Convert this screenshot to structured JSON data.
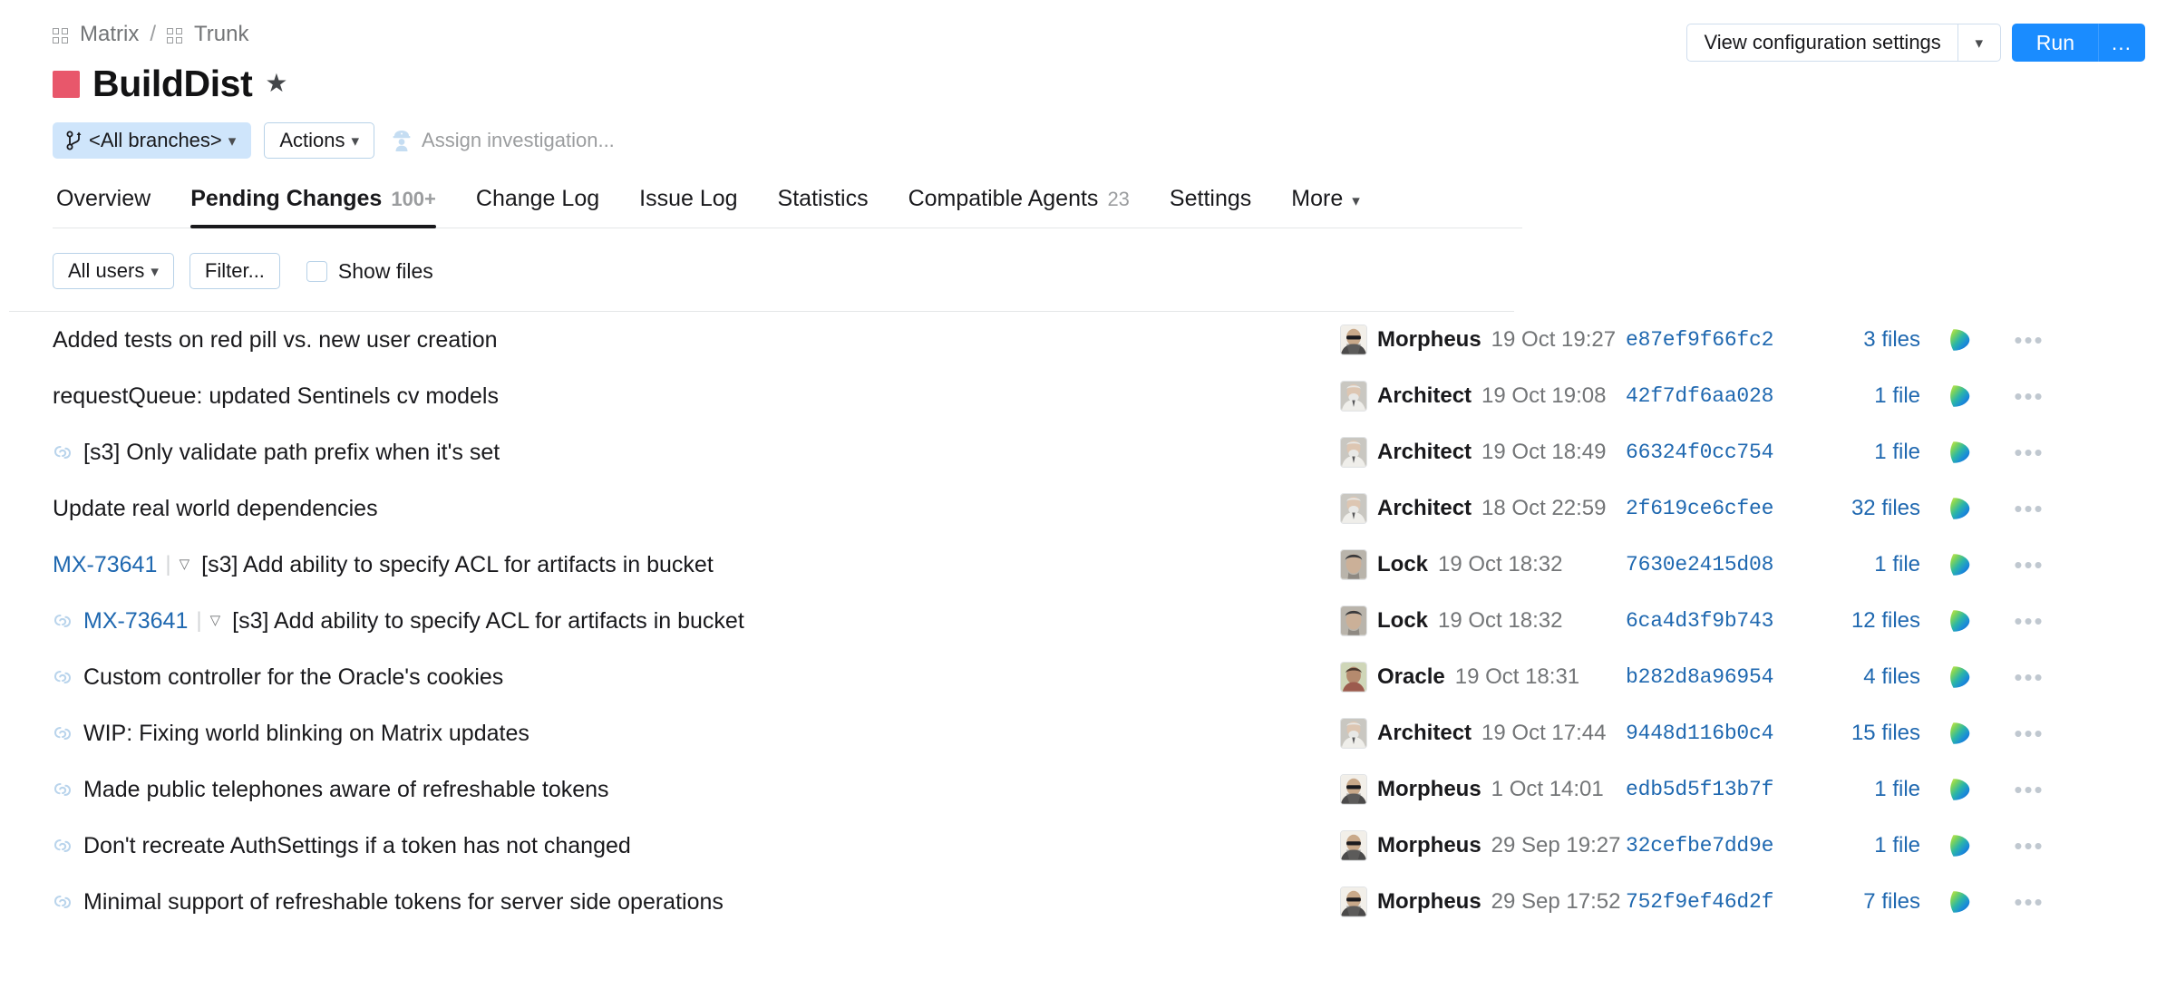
{
  "breadcrumb": {
    "root": "Matrix",
    "separator": "/",
    "child": "Trunk"
  },
  "project": {
    "title": "BuildDist",
    "star": "★",
    "color": "#e8576b"
  },
  "actions": {
    "branch_label": "<All branches>",
    "actions_label": "Actions",
    "assign_label": "Assign investigation..."
  },
  "topbar": {
    "view_config_label": "View configuration settings",
    "run_label": "Run",
    "more_label": "..."
  },
  "tabs": [
    {
      "label": "Overview",
      "count": "",
      "active": false
    },
    {
      "label": "Pending Changes",
      "count": "100+",
      "active": true
    },
    {
      "label": "Change Log",
      "count": "",
      "active": false
    },
    {
      "label": "Issue Log",
      "count": "",
      "active": false
    },
    {
      "label": "Statistics",
      "count": "",
      "active": false
    },
    {
      "label": "Compatible Agents",
      "count": "23",
      "active": false
    },
    {
      "label": "Settings",
      "count": "",
      "active": false
    },
    {
      "label": "More",
      "count": "",
      "active": false,
      "caret": true
    }
  ],
  "filters": {
    "users_label": "All users",
    "filter_label": "Filter...",
    "show_files_label": "Show files",
    "show_files_checked": false
  },
  "changes": [
    {
      "link": false,
      "issue": "",
      "description": "Added tests on red pill vs. new user creation",
      "author": "Morpheus",
      "avatar": "morpheus",
      "date": "19 Oct 19:27",
      "hash": "e87ef9f66fc2",
      "files": "3 files"
    },
    {
      "link": false,
      "issue": "",
      "description": "requestQueue: updated Sentinels cv models",
      "author": "Architect",
      "avatar": "architect",
      "date": "19 Oct 19:08",
      "hash": "42f7df6aa028",
      "files": "1 file"
    },
    {
      "link": true,
      "issue": "",
      "description": "[s3] Only validate path prefix when it's set",
      "author": "Architect",
      "avatar": "architect",
      "date": "19 Oct 18:49",
      "hash": "66324f0cc754",
      "files": "1 file"
    },
    {
      "link": false,
      "issue": "",
      "description": "Update real world dependencies",
      "author": "Architect",
      "avatar": "architect",
      "date": "18 Oct 22:59",
      "hash": "2f619ce6cfee",
      "files": "32 files"
    },
    {
      "link": false,
      "issue": "MX-73641",
      "description": "[s3] Add ability to specify ACL for artifacts in bucket",
      "author": "Lock",
      "avatar": "lock",
      "date": "19 Oct 18:32",
      "hash": "7630e2415d08",
      "files": "1 file"
    },
    {
      "link": true,
      "issue": "MX-73641",
      "description": "[s3] Add ability to specify ACL for artifacts in bucket",
      "author": "Lock",
      "avatar": "lock",
      "date": "19 Oct 18:32",
      "hash": "6ca4d3f9b743",
      "files": "12 files"
    },
    {
      "link": true,
      "issue": "",
      "description": "Custom controller for the Oracle's cookies",
      "author": "Oracle",
      "avatar": "oracle",
      "date": "19 Oct 18:31",
      "hash": "b282d8a96954",
      "files": "4 files"
    },
    {
      "link": true,
      "issue": "",
      "description": "WIP: Fixing world blinking on Matrix updates",
      "author": "Architect",
      "avatar": "architect",
      "date": "19 Oct 17:44",
      "hash": "9448d116b0c4",
      "files": "15 files"
    },
    {
      "link": true,
      "issue": "",
      "description": "Made public telephones aware of refreshable tokens",
      "author": "Morpheus",
      "avatar": "morpheus",
      "date": "1 Oct 14:01",
      "hash": "edb5d5f13b7f",
      "files": "1 file"
    },
    {
      "link": true,
      "issue": "",
      "description": "Don't recreate AuthSettings if a token has not changed",
      "author": "Morpheus",
      "avatar": "morpheus",
      "date": "29 Sep 19:27",
      "hash": "32cefbe7dd9e",
      "files": "1 file"
    },
    {
      "link": true,
      "issue": "",
      "description": "Minimal support of refreshable tokens for server side operations",
      "author": "Morpheus",
      "avatar": "morpheus",
      "date": "29 Sep 17:52",
      "hash": "752f9ef46d2f",
      "files": "7 files"
    }
  ],
  "row_menu_label": "•••",
  "colors": {
    "accent_blue": "#1a8cff",
    "link_blue": "#1f68b0",
    "project_red": "#e8576b",
    "branch_chip": "#cfe5fb"
  }
}
